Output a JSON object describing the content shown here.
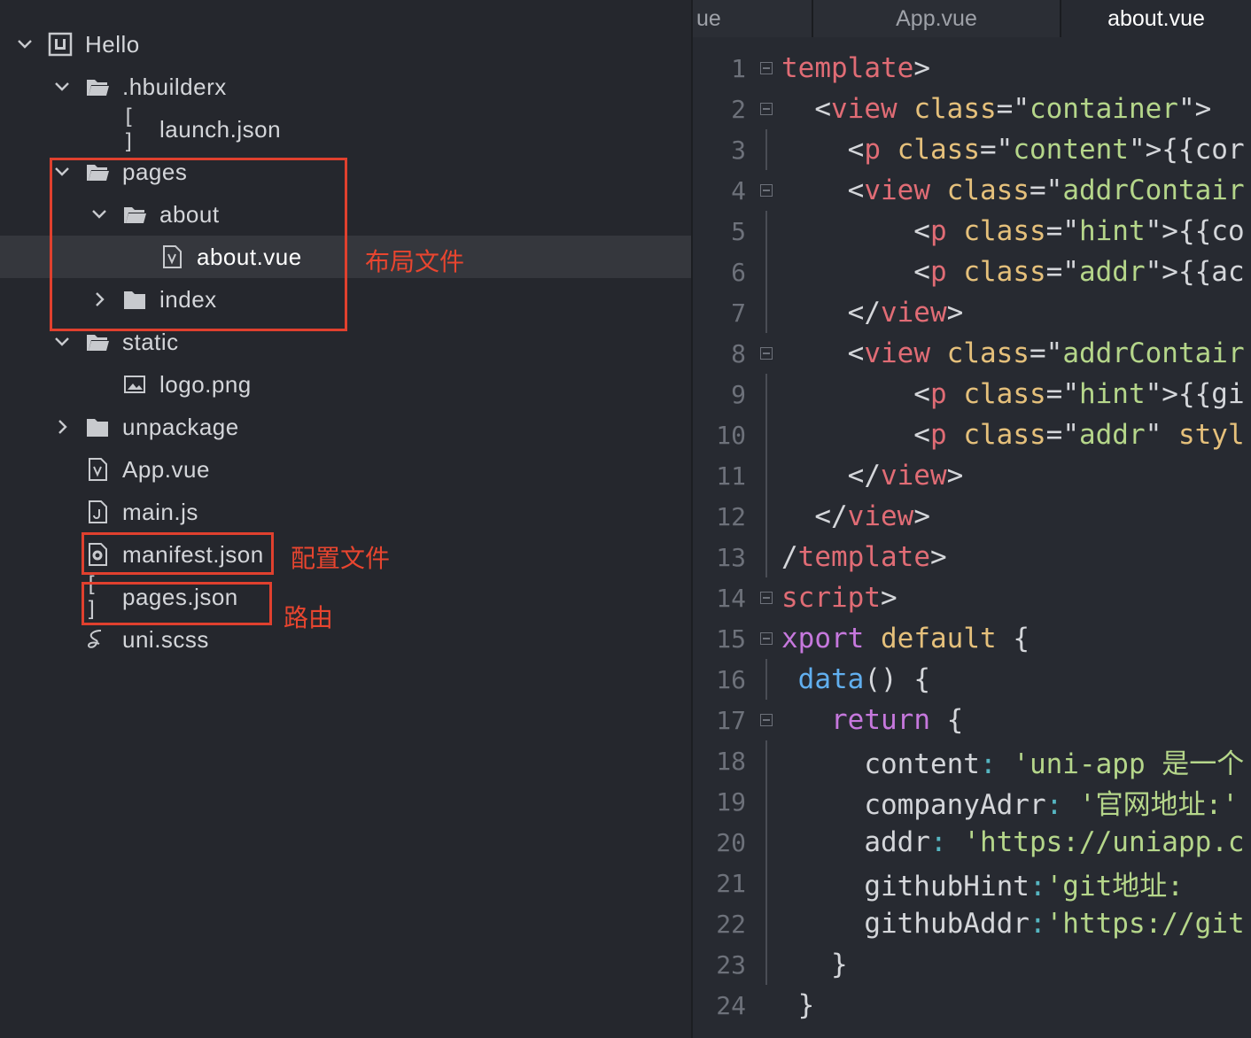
{
  "sidebar": {
    "items": [
      {
        "label": "Hello",
        "depth": 0,
        "expander": "open",
        "icon": "project-icon"
      },
      {
        "label": ".hbuilderx",
        "depth": 1,
        "expander": "open",
        "icon": "folder-open-icon"
      },
      {
        "label": "launch.json",
        "depth": 2,
        "expander": "none",
        "icon": "json-bracket-icon",
        "icon_text": "[ ]"
      },
      {
        "label": "pages",
        "depth": 1,
        "expander": "open",
        "icon": "folder-open-icon"
      },
      {
        "label": "about",
        "depth": 2,
        "expander": "open",
        "icon": "folder-open-icon"
      },
      {
        "label": "about.vue",
        "depth": 3,
        "expander": "none",
        "icon": "vue-file-icon",
        "selected": true
      },
      {
        "label": "index",
        "depth": 2,
        "expander": "closed",
        "icon": "folder-icon"
      },
      {
        "label": "static",
        "depth": 1,
        "expander": "open",
        "icon": "folder-open-icon"
      },
      {
        "label": "logo.png",
        "depth": 2,
        "expander": "none",
        "icon": "image-file-icon"
      },
      {
        "label": "unpackage",
        "depth": 1,
        "expander": "closed",
        "icon": "folder-icon"
      },
      {
        "label": "App.vue",
        "depth": 1,
        "expander": "none",
        "icon": "vue-file-icon"
      },
      {
        "label": "main.js",
        "depth": 1,
        "expander": "none",
        "icon": "js-file-icon"
      },
      {
        "label": "manifest.json",
        "depth": 1,
        "expander": "none",
        "icon": "gear-file-icon"
      },
      {
        "label": "pages.json",
        "depth": 1,
        "expander": "none",
        "icon": "json-bracket-icon",
        "icon_text": "[ ]"
      },
      {
        "label": "uni.scss",
        "depth": 1,
        "expander": "none",
        "icon": "sass-file-icon"
      }
    ]
  },
  "annotations": {
    "layout_file": "布局文件",
    "config_file": "配置文件",
    "routing": "路由",
    "color": "#e0402e"
  },
  "editor": {
    "tabs": [
      {
        "label": "ue",
        "active": false
      },
      {
        "label": "App.vue",
        "active": false
      },
      {
        "label": "about.vue",
        "active": true
      }
    ],
    "lines": [
      {
        "n": "1",
        "fold": true,
        "guide": false,
        "tokens": [
          [
            "tag",
            "template"
          ],
          [
            "pun",
            ">"
          ]
        ]
      },
      {
        "n": "2",
        "fold": true,
        "guide": false,
        "tokens": [
          [
            "pun",
            "  <"
          ],
          [
            "tag",
            "view"
          ],
          [
            "pun",
            " "
          ],
          [
            "attr",
            "class"
          ],
          [
            "pun",
            "=\""
          ],
          [
            "str",
            "container"
          ],
          [
            "pun",
            "\">"
          ]
        ]
      },
      {
        "n": "3",
        "fold": false,
        "guide": true,
        "tokens": [
          [
            "pun",
            "    <"
          ],
          [
            "tag",
            "p"
          ],
          [
            "pun",
            " "
          ],
          [
            "attr",
            "class"
          ],
          [
            "pun",
            "=\""
          ],
          [
            "str",
            "content"
          ],
          [
            "pun",
            "\">{{cor"
          ]
        ]
      },
      {
        "n": "4",
        "fold": true,
        "guide": false,
        "tokens": [
          [
            "pun",
            "    <"
          ],
          [
            "tag",
            "view"
          ],
          [
            "pun",
            " "
          ],
          [
            "attr",
            "class"
          ],
          [
            "pun",
            "=\""
          ],
          [
            "str",
            "addrContair"
          ]
        ]
      },
      {
        "n": "5",
        "fold": false,
        "guide": true,
        "tokens": [
          [
            "pun",
            "        <"
          ],
          [
            "tag",
            "p"
          ],
          [
            "pun",
            " "
          ],
          [
            "attr",
            "class"
          ],
          [
            "pun",
            "=\""
          ],
          [
            "str",
            "hint"
          ],
          [
            "pun",
            "\">{{co"
          ]
        ]
      },
      {
        "n": "6",
        "fold": false,
        "guide": true,
        "tokens": [
          [
            "pun",
            "        <"
          ],
          [
            "tag",
            "p"
          ],
          [
            "pun",
            " "
          ],
          [
            "attr",
            "class"
          ],
          [
            "pun",
            "=\""
          ],
          [
            "str",
            "addr"
          ],
          [
            "pun",
            "\">{{ac"
          ]
        ]
      },
      {
        "n": "7",
        "fold": false,
        "guide": true,
        "tokens": [
          [
            "pun",
            "    </"
          ],
          [
            "tag",
            "view"
          ],
          [
            "pun",
            ">"
          ]
        ]
      },
      {
        "n": "8",
        "fold": true,
        "guide": false,
        "tokens": [
          [
            "pun",
            "    <"
          ],
          [
            "tag",
            "view"
          ],
          [
            "pun",
            " "
          ],
          [
            "attr",
            "class"
          ],
          [
            "pun",
            "=\""
          ],
          [
            "str",
            "addrContair"
          ]
        ]
      },
      {
        "n": "9",
        "fold": false,
        "guide": true,
        "tokens": [
          [
            "pun",
            "        <"
          ],
          [
            "tag",
            "p"
          ],
          [
            "pun",
            " "
          ],
          [
            "attr",
            "class"
          ],
          [
            "pun",
            "=\""
          ],
          [
            "str",
            "hint"
          ],
          [
            "pun",
            "\">{{gi"
          ]
        ]
      },
      {
        "n": "10",
        "fold": false,
        "guide": true,
        "tokens": [
          [
            "pun",
            "        <"
          ],
          [
            "tag",
            "p"
          ],
          [
            "pun",
            " "
          ],
          [
            "attr",
            "class"
          ],
          [
            "pun",
            "=\""
          ],
          [
            "str",
            "addr"
          ],
          [
            "pun",
            "\" "
          ],
          [
            "attr",
            "styl"
          ]
        ]
      },
      {
        "n": "11",
        "fold": false,
        "guide": true,
        "tokens": [
          [
            "pun",
            "    </"
          ],
          [
            "tag",
            "view"
          ],
          [
            "pun",
            ">"
          ]
        ]
      },
      {
        "n": "12",
        "fold": false,
        "guide": true,
        "tokens": [
          [
            "pun",
            "  </"
          ],
          [
            "tag",
            "view"
          ],
          [
            "pun",
            ">"
          ]
        ]
      },
      {
        "n": "13",
        "fold": false,
        "guide": true,
        "tokens": [
          [
            "pun",
            "/"
          ],
          [
            "tag",
            "template"
          ],
          [
            "pun",
            ">"
          ]
        ]
      },
      {
        "n": "14",
        "fold": true,
        "guide": false,
        "tokens": [
          [
            "tag",
            "script"
          ],
          [
            "pun",
            ">"
          ]
        ]
      },
      {
        "n": "15",
        "fold": true,
        "guide": false,
        "tokens": [
          [
            "kw",
            "xport"
          ],
          [
            "pun",
            " "
          ],
          [
            "attr",
            "default"
          ],
          [
            "pun",
            " {"
          ]
        ]
      },
      {
        "n": "16",
        "fold": false,
        "guide": true,
        "tokens": [
          [
            "pun",
            " "
          ],
          [
            "fn",
            "data"
          ],
          [
            "pun",
            "() {"
          ]
        ]
      },
      {
        "n": "17",
        "fold": true,
        "guide": false,
        "tokens": [
          [
            "pun",
            "   "
          ],
          [
            "kw",
            "return"
          ],
          [
            "pun",
            " {"
          ]
        ]
      },
      {
        "n": "18",
        "fold": false,
        "guide": true,
        "tokens": [
          [
            "prop",
            "     content"
          ],
          [
            "cyan",
            ":"
          ],
          [
            "str",
            " 'uni-app 是一个"
          ]
        ]
      },
      {
        "n": "19",
        "fold": false,
        "guide": true,
        "tokens": [
          [
            "prop",
            "     companyAdrr"
          ],
          [
            "cyan",
            ":"
          ],
          [
            "str",
            " '官网地址:'"
          ]
        ]
      },
      {
        "n": "20",
        "fold": false,
        "guide": true,
        "tokens": [
          [
            "prop",
            "     addr"
          ],
          [
            "cyan",
            ":"
          ],
          [
            "str",
            " 'https://uniapp.c"
          ]
        ]
      },
      {
        "n": "21",
        "fold": false,
        "guide": true,
        "tokens": [
          [
            "prop",
            "     githubHint"
          ],
          [
            "cyan",
            ":"
          ],
          [
            "str",
            "'git地址:"
          ]
        ]
      },
      {
        "n": "22",
        "fold": false,
        "guide": true,
        "tokens": [
          [
            "prop",
            "     githubAddr"
          ],
          [
            "cyan",
            ":"
          ],
          [
            "str",
            "'https://git"
          ]
        ]
      },
      {
        "n": "23",
        "fold": false,
        "guide": true,
        "tokens": [
          [
            "pun",
            "   }"
          ]
        ]
      },
      {
        "n": "24",
        "fold": false,
        "guide": false,
        "tokens": [
          [
            "pun",
            " }"
          ]
        ]
      }
    ]
  }
}
